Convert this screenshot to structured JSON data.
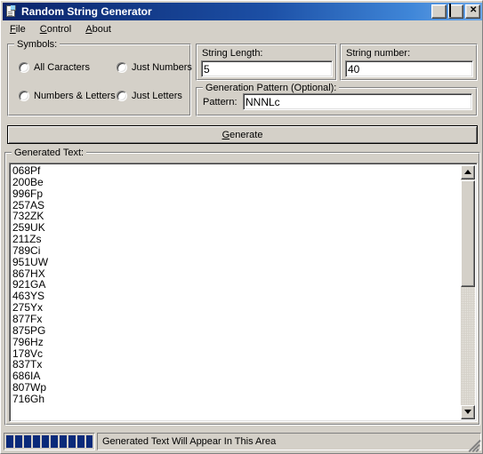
{
  "window": {
    "title": "Random String Generator",
    "icon": "document-icon",
    "controls": {
      "minimize": "_",
      "maximize": "□",
      "close": "✕"
    }
  },
  "menubar": {
    "items": [
      {
        "label": "File",
        "accel": "F"
      },
      {
        "label": "Control",
        "accel": "C"
      },
      {
        "label": "About",
        "accel": "A"
      }
    ]
  },
  "symbols": {
    "title": "Symbols:",
    "options": [
      {
        "label": "All Caracters",
        "selected": false
      },
      {
        "label": "Just Numbers",
        "selected": false
      },
      {
        "label": "Numbers & Letters",
        "selected": false
      },
      {
        "label": "Just Letters",
        "selected": false
      }
    ]
  },
  "string_length": {
    "title": "String Length:",
    "value": "5",
    "placeholder": ""
  },
  "string_number": {
    "title": "String number:",
    "value": "40",
    "placeholder": ""
  },
  "pattern": {
    "title": "Generation Pattern (Optional):",
    "label": "Pattern:",
    "value": "NNNLc",
    "placeholder": ""
  },
  "generate": {
    "label": "Generate",
    "accel": "G"
  },
  "generated": {
    "title": "Generated Text:",
    "lines": [
      "068Pf",
      "200Be",
      "996Fp",
      "257AS",
      "732ZK",
      "259UK",
      "211Zs",
      "789Ci",
      "951UW",
      "867HX",
      "921GA",
      "463YS",
      "275Yx",
      "877Fx",
      "875PG",
      "796Hz",
      "178Vc",
      "837Tx",
      "686IA",
      "807Wp",
      "716Gh"
    ]
  },
  "statusbar": {
    "progress_blocks": 10,
    "progress_color": "#0a2a7a",
    "text": "Generated Text Will Appear In This Area"
  },
  "colors": {
    "face": "#d4d0c8",
    "title_left": "#0a246a",
    "title_right": "#6ba6e8",
    "field_bg": "#ffffff"
  }
}
